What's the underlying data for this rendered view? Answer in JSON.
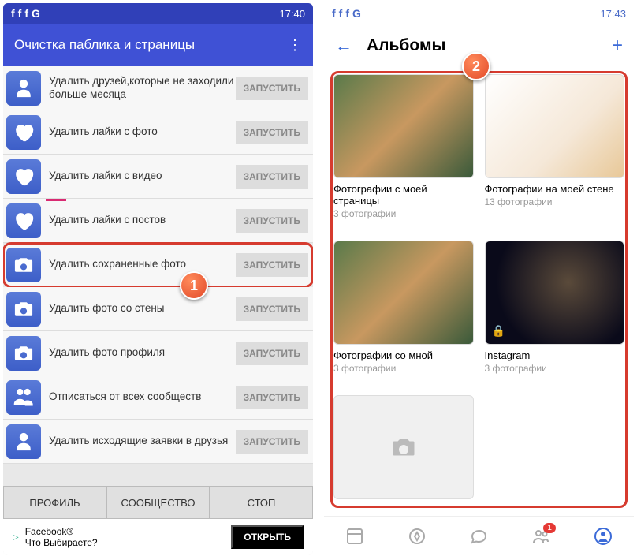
{
  "left": {
    "status": {
      "time": "17:40"
    },
    "header": {
      "title": "Очистка паблика и страницы"
    },
    "rows": [
      {
        "icon": "person",
        "label": "Удалить друзей,которые не заходили больше месяца",
        "btn": "ЗАПУСТИТЬ"
      },
      {
        "icon": "heart",
        "label": "Удалить лайки с фото",
        "btn": "ЗАПУСТИТЬ"
      },
      {
        "icon": "heart",
        "label": "Удалить лайки с видео",
        "btn": "ЗАПУСТИТЬ"
      },
      {
        "icon": "heart",
        "label": "Удалить лайки с постов",
        "btn": "ЗАПУСТИТЬ",
        "pink": true
      },
      {
        "icon": "camera",
        "label": "Удалить сохраненные фото",
        "btn": "ЗАПУСТИТЬ",
        "hl": true
      },
      {
        "icon": "camera",
        "label": "Удалить фото со стены",
        "btn": "ЗАПУСТИТЬ"
      },
      {
        "icon": "camera",
        "label": "Удалить фото профиля",
        "btn": "ЗАПУСТИТЬ"
      },
      {
        "icon": "group",
        "label": "Отписаться от всех сообществ",
        "btn": "ЗАПУСТИТЬ"
      },
      {
        "icon": "person",
        "label": "Удалить исходящие заявки в друзья",
        "btn": "ЗАПУСТИТЬ"
      }
    ],
    "bottom": {
      "profile": "ПРОФИЛЬ",
      "community": "СООБЩЕСТВО",
      "stop": "СТОП"
    },
    "ad": {
      "line1": "Facebook®",
      "line2": "Что Выбираете?",
      "open": "ОТКРЫТЬ"
    }
  },
  "right": {
    "status": {
      "time": "17:43"
    },
    "header": {
      "title": "Альбомы"
    },
    "albums": [
      {
        "thumb": "dog",
        "title": "Фотографии с моей страницы",
        "count": "3 фотографии"
      },
      {
        "thumb": "fox",
        "title": "Фотографии на моей стене",
        "count": "13 фотографии"
      },
      {
        "thumb": "dog",
        "title": "Фотографии со мной",
        "count": "3 фотографии"
      },
      {
        "thumb": "space",
        "title": "Instagram",
        "count": "3 фотографии",
        "lock": true
      },
      {
        "thumb": "empty"
      }
    ],
    "nav": {
      "badge": "1"
    }
  },
  "callouts": {
    "c1": "1",
    "c2": "2"
  }
}
